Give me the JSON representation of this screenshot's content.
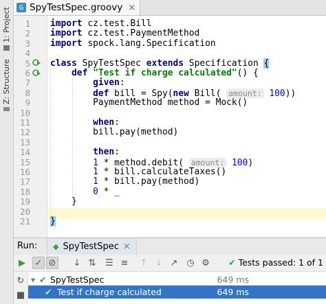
{
  "sidebar": {
    "project_label": "1: Project",
    "structure_label": "Z: Structure"
  },
  "editor": {
    "tab_title": "SpyTestSpec.groovy",
    "file_icon_text": "G",
    "close_glyph": "×",
    "lines": [
      {
        "n": "1",
        "html": "<span class='kw'>import</span> cz.test.Bill"
      },
      {
        "n": "2",
        "html": "<span class='kw'>import</span> cz.test.PaymentMethod"
      },
      {
        "n": "3",
        "html": "<span class='kw'>import</span> spock.lang.Specification"
      },
      {
        "n": "4",
        "html": ""
      },
      {
        "n": "5",
        "html": "<span class='kw'>class</span> SpyTestSpec <span class='kw'>extends</span> Specification <span class='brace-hl'>{</span>"
      },
      {
        "n": "6",
        "html": "    <span class='kw'>def</span> <span class='str'>\"Test if charge calculated\"</span>() {"
      },
      {
        "n": "7",
        "html": "        <span class='kw'>given</span>:"
      },
      {
        "n": "8",
        "html": "        <span class='kw'>def</span> bill = Spy(<span class='kw'>new</span> Bill( <span class='hint'>amount:</span> <span class='num'>100</span>))"
      },
      {
        "n": "9",
        "html": "        PaymentMethod method = Mock()"
      },
      {
        "n": "10",
        "html": ""
      },
      {
        "n": "11",
        "html": "        <span class='kw'>when</span>:"
      },
      {
        "n": "12",
        "html": "        bill.pay(method)"
      },
      {
        "n": "13",
        "html": ""
      },
      {
        "n": "14",
        "html": "        <span class='kw'>then</span>:"
      },
      {
        "n": "15",
        "html": "        <span class='num'>1</span> * method.debit( <span class='hint'>amount:</span> <span class='num'>100</span>)"
      },
      {
        "n": "16",
        "html": "        <span class='num'>1</span> * bill.calculateTaxes()"
      },
      {
        "n": "17",
        "html": "        <span class='num'>1</span> * bill.pay(method)"
      },
      {
        "n": "18",
        "html": "        <span class='num'>0</span> * _"
      },
      {
        "n": "19",
        "html": "    }"
      },
      {
        "n": "20",
        "html": ""
      },
      {
        "n": "21",
        "html": "<span class='brace-hl'>}</span>"
      }
    ]
  },
  "run_panel": {
    "label": "Run:",
    "tab_title": "SpyTestSpec",
    "status_text": "Tests passed: 1 of 1",
    "results": [
      {
        "name": "SpyTestSpec",
        "time": "649 ms",
        "level": 0
      },
      {
        "name": "Test if charge calculated",
        "time": "649 ms",
        "level": 1
      }
    ]
  },
  "colors": {
    "keyword": "#000080",
    "string": "#008000",
    "number": "#0000ff",
    "selection": "#3574c4",
    "pass": "#3e9a3e"
  }
}
